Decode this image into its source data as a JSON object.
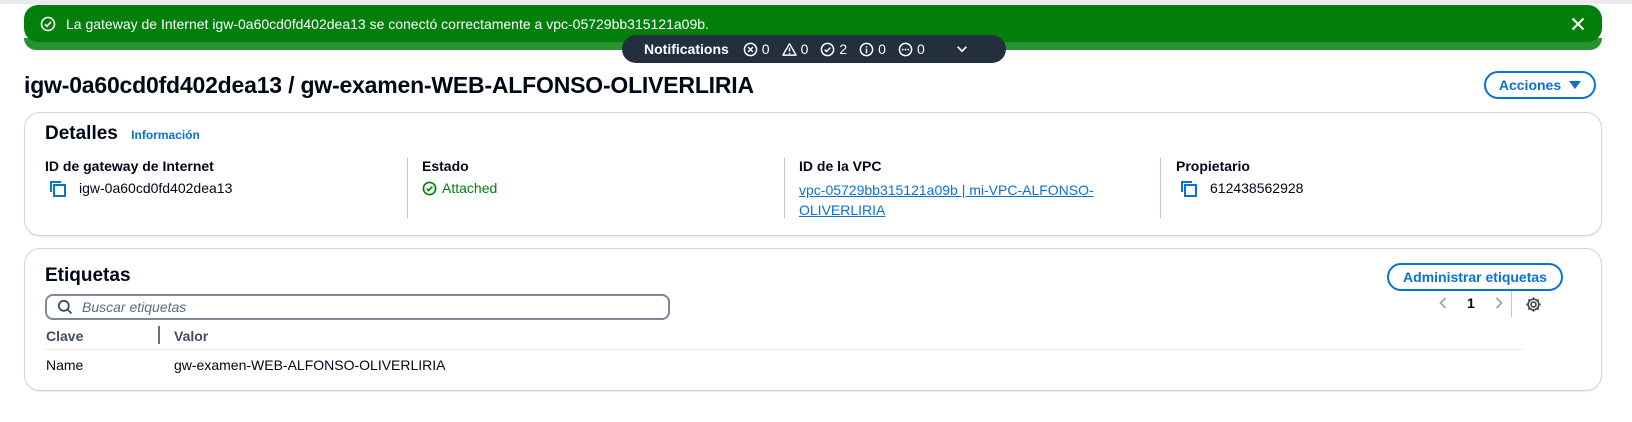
{
  "flash": {
    "message": "La gateway de Internet igw-0a60cd0fd402dea13 se conectó correctamente a vpc-05729bb315121a09b."
  },
  "notifications": {
    "title": "Notifications",
    "errors": "0",
    "warnings": "0",
    "success": "2",
    "info": "0",
    "in_progress": "0"
  },
  "header": {
    "title": "igw-0a60cd0fd402dea13 / gw-examen-WEB-ALFONSO-OLIVERLIRIA",
    "actions_label": "Acciones"
  },
  "details": {
    "title": "Detalles",
    "info_link": "Información",
    "fields": [
      {
        "label": "ID de gateway de Internet",
        "value": "igw-0a60cd0fd402dea13"
      },
      {
        "label": "Estado",
        "value": "Attached"
      },
      {
        "label": "ID de la VPC",
        "value": "vpc-05729bb315121a09b | mi-VPC-ALFONSO-OLIVERLIRIA"
      },
      {
        "label": "Propietario",
        "value": "612438562928"
      }
    ]
  },
  "tags": {
    "title": "Etiquetas",
    "manage_label": "Administrar etiquetas",
    "search_placeholder": "Buscar etiquetas",
    "page": "1",
    "columns": [
      "Clave",
      "Valor"
    ],
    "rows": [
      {
        "key": "Name",
        "value": "gw-examen-WEB-ALFONSO-OLIVERLIRIA"
      }
    ]
  },
  "colors": {
    "success": "#037f0c",
    "primary": "#0972d3",
    "notification_bg": "#232f3e"
  }
}
